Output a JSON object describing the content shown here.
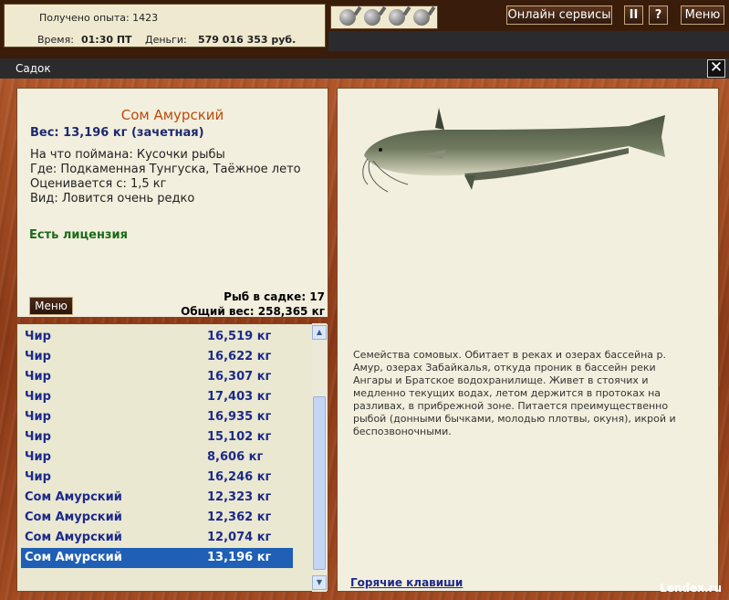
{
  "hud": {
    "experience": "Получено опыта: 1423",
    "time_label": "Время:",
    "time_value": "01:30 ПТ",
    "money_label": "Деньги:",
    "money_value": "579 016 353 руб."
  },
  "top_buttons": {
    "online": "Онлайн сервисы",
    "pause": "II",
    "help": "?",
    "menu": "Меню"
  },
  "bait_icons": [
    "bait-icon",
    "bait-icon",
    "bait-icon",
    "bait-icon"
  ],
  "window": {
    "title": "Садок",
    "close": "✕"
  },
  "fish_info": {
    "name": "Сом Амурский",
    "weight": "Вес: 13,196 кг (зачетная)",
    "caught_with": "На что поймана: Кусочки рыбы",
    "where": "Где: Подкаменная Тунгуска, Таёжное лето",
    "valued_from": "Оценивается с: 1,5 кг",
    "view": "Вид: Ловится очень редко",
    "license": "Есть лицензия",
    "count": "Рыб в садке: 17",
    "total": "Общий вес: 258,365 кг",
    "menu_button": "Меню"
  },
  "fish_list": [
    {
      "name": "Чир",
      "weight": "16,519 кг"
    },
    {
      "name": "Чир",
      "weight": "16,622 кг"
    },
    {
      "name": "Чир",
      "weight": "16,307 кг"
    },
    {
      "name": "Чир",
      "weight": "17,403 кг"
    },
    {
      "name": "Чир",
      "weight": "16,935 кг"
    },
    {
      "name": "Чир",
      "weight": "15,102 кг"
    },
    {
      "name": "Чир",
      "weight": "8,606 кг"
    },
    {
      "name": "Чир",
      "weight": "16,246 кг"
    },
    {
      "name": "Сом Амурский",
      "weight": "12,323 кг"
    },
    {
      "name": "Сом Амурский",
      "weight": "12,362 кг"
    },
    {
      "name": "Сом Амурский",
      "weight": "12,074 кг"
    },
    {
      "name": "Сом Амурский",
      "weight": "13,196 кг",
      "selected": true
    }
  ],
  "description": {
    "text": "Семейства сомовых. Обитает в реках и озерах бассейна р. Амур, озерах Забайкалья, откуда проник в бассейн реки Ангары и Братское водохранилище. Живет в стоячих и медленно текущих водах, летом держится в протоках на разливах, в прибрежной зоне. Питается преимущественно рыбой (донными бычками, молодью плотвы, окуня), икрой и беспозвоночными.",
    "hotkeys": "Горячие клавиши"
  },
  "watermark": "Lendex.ru"
}
